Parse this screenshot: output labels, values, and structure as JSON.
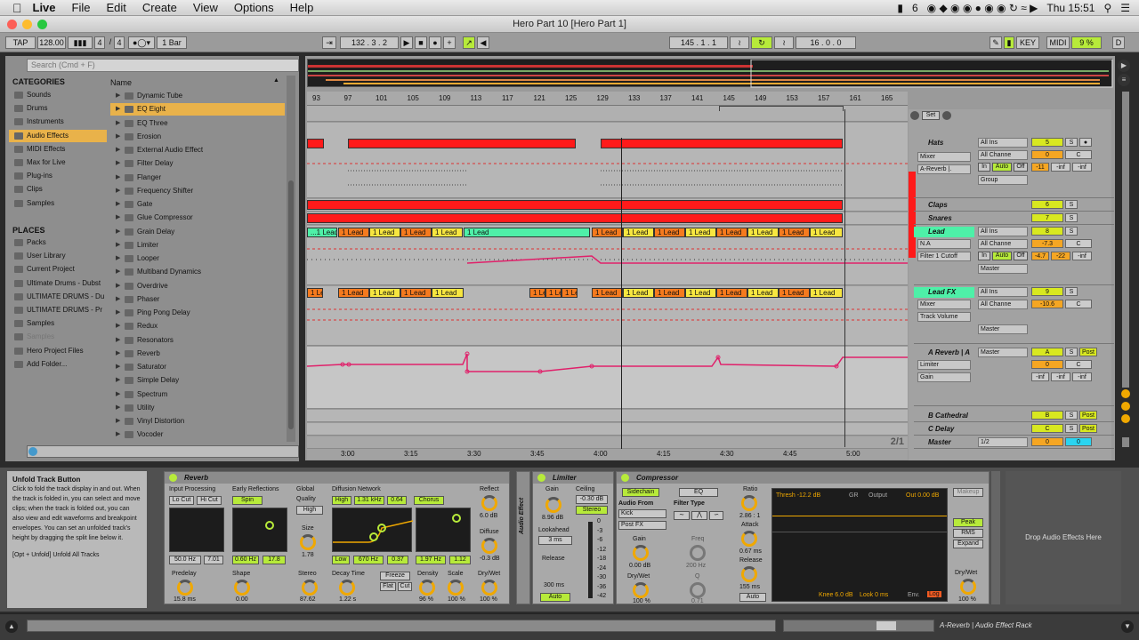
{
  "menubar": {
    "app": "Live",
    "items": [
      "File",
      "Edit",
      "Create",
      "View",
      "Options",
      "Help"
    ],
    "right": {
      "battery_num": "6",
      "clock": "Thu 15:51"
    }
  },
  "window": {
    "title": "Hero Part 10  [Hero Part 1]"
  },
  "transport": {
    "tap": "TAP",
    "bpm": "128.00",
    "meter_num": "4",
    "meter_den": "4",
    "quant": "1 Bar",
    "position": "132 .  3 .  2",
    "loop_start": "145 .  1 .  1",
    "loop_len": "16 .  0 .  0",
    "key": "KEY",
    "midi": "MIDI",
    "cpu": "9 %",
    "d": "D"
  },
  "browser": {
    "search_placeholder": "Search (Cmd + F)",
    "categories_label": "CATEGORIES",
    "name_header": "Name",
    "places_label": "PLACES",
    "categories": [
      "Sounds",
      "Drums",
      "Instruments",
      "Audio Effects",
      "MIDI Effects",
      "Max for Live",
      "Plug-ins",
      "Clips",
      "Samples"
    ],
    "places": [
      "Packs",
      "User Library",
      "Current Project",
      "Ultimate Drums - Dubst",
      "ULTIMATE DRUMS - Du",
      "ULTIMATE DRUMS - Pr",
      "Samples",
      "Samples",
      "Hero Project Files",
      "Add Folder..."
    ],
    "files": [
      "Dynamic Tube",
      "EQ Eight",
      "EQ Three",
      "Erosion",
      "External Audio Effect",
      "Filter Delay",
      "Flanger",
      "Frequency Shifter",
      "Gate",
      "Glue Compressor",
      "Grain Delay",
      "Limiter",
      "Looper",
      "Multiband Dynamics",
      "Overdrive",
      "Phaser",
      "Ping Pong Delay",
      "Redux",
      "Resonators",
      "Reverb",
      "Saturator",
      "Simple Delay",
      "Spectrum",
      "Utility",
      "Vinyl Distortion",
      "Vocoder"
    ]
  },
  "ruler": {
    "bars": [
      "93",
      "97",
      "101",
      "105",
      "109",
      "113",
      "117",
      "121",
      "125",
      "129",
      "133",
      "137",
      "141",
      "145",
      "149",
      "153",
      "157",
      "161",
      "165"
    ],
    "times": [
      "3:00",
      "3:15",
      "3:30",
      "3:45",
      "4:00",
      "4:15",
      "4:30",
      "4:45",
      "5:00"
    ],
    "page": "2/1",
    "set": "Set"
  },
  "clips": {
    "lead_label": "1 Lead",
    "lead_short": "1 Le",
    "lead_first": "...1 Lead"
  },
  "tracks": {
    "hats": {
      "name": "Hats",
      "input": "All Ins",
      "chain": "Mixer",
      "channel": "All Channe",
      "param": "A-Reverb |.",
      "in": "In",
      "auto": "Auto",
      "off": "Off",
      "group": "Group",
      "num": "5",
      "vol": "0",
      "pan": "C",
      "s1": "-11",
      "s2": "-inf",
      "s3": "-inf"
    },
    "claps": {
      "name": "Claps",
      "num": "6"
    },
    "snares": {
      "name": "Snares",
      "num": "7"
    },
    "lead": {
      "name": "Lead",
      "input": "All Ins",
      "chain": "N.A",
      "param": "Filter 1 Cutoff",
      "channel": "All Channe",
      "out": "Master",
      "num": "8",
      "vol": "-7.3",
      "pan": "C",
      "s1": "-4.7",
      "s2": "-22",
      "s3": "-inf"
    },
    "leadfx": {
      "name": "Lead FX",
      "input": "All Ins",
      "chain": "Mixer",
      "param": "Track Volume",
      "channel": "All Channe",
      "out": "Master",
      "num": "9",
      "vol": "-10.6",
      "pan": "C"
    },
    "areverb": {
      "name": "A Reverb | A",
      "out": "Master",
      "chain": "Limiter",
      "param": "Gain",
      "num": "A",
      "vol": "0",
      "pan": "C",
      "post": "Post"
    },
    "bcathedral": {
      "name": "B Cathedral",
      "num": "B",
      "post": "Post"
    },
    "cdelay": {
      "name": "C Delay",
      "num": "C",
      "post": "Post"
    },
    "master": {
      "name": "Master",
      "cue": "1/2",
      "vol": "0",
      "pan": "0"
    },
    "s_label": "S",
    "inf": "-inf"
  },
  "info": {
    "title": "Unfold Track Button",
    "body": "Click to fold the track display in and out. When the track is folded in, you can select and move clips; when the track is folded out, you can also view and edit waveforms and breakpoint envelopes. You can set an unfolded track's height by dragging the split line below it.",
    "shortcut": "[Opt + Unfold] Unfold All Tracks"
  },
  "reverb": {
    "title": "Reverb",
    "input_proc": "Input Processing",
    "lo_cut": "Lo Cut",
    "hi_cut": "Hi Cut",
    "in_lo": "50.0 Hz",
    "in_hi": "7.01",
    "predelay_label": "Predelay",
    "predelay": "15.8 ms",
    "early": "Early Reflections",
    "spin": "Spin",
    "spin_rate": "0.60 Hz",
    "spin_amt": "17.8",
    "shape_label": "Shape",
    "shape": "0.00",
    "global": "Global",
    "quality_label": "Quality",
    "quality": "High",
    "size_label": "Size",
    "size": "1.78",
    "stereo_label": "Stereo",
    "stereo": "87.62",
    "diffusion": "Diffusion Network",
    "high": "High",
    "high_freq": "1.31 kHz",
    "high_amt": "0.64",
    "chorus": "Chorus",
    "low": "Low",
    "low_freq": "670 Hz",
    "low_amt": "0.37",
    "chorus_rate": "1.97 Hz",
    "chorus_amt": "1.12",
    "decay_label": "Decay Time",
    "decay": "1.22 s",
    "freeze": "Freeze",
    "flat": "Flat",
    "cut": "Cut",
    "density_label": "Density",
    "density": "96 %",
    "scale_label": "Scale",
    "scale": "100 %",
    "reflect_label": "Reflect",
    "reflect": "6.0 dB",
    "diffuse_label": "Diffuse",
    "diffuse": "-0.3 dB",
    "drywet_label": "Dry/Wet",
    "drywet": "100 %"
  },
  "rack_label": "Audio Effect",
  "limiter": {
    "title": "Limiter",
    "gain_label": "Gain",
    "gain": "8.96 dB",
    "ceiling_label": "Ceiling",
    "ceiling": "-0.30 dB",
    "stereo": "Stereo",
    "lookahead_label": "Lookahead",
    "lookahead": "3 ms",
    "release_label": "Release",
    "release": "300 ms",
    "auto": "Auto",
    "scale": [
      "0",
      "-3",
      "-6",
      "-12",
      "-18",
      "-24",
      "-30",
      "-36",
      "-42"
    ]
  },
  "compressor": {
    "title": "Compressor",
    "sidechain": "Sidechain",
    "eq": "EQ",
    "audio_from": "Audio From",
    "source": "Kick",
    "tap": "Post FX",
    "gain_label": "Gain",
    "gain": "0.00 dB",
    "drywet_label": "Dry/Wet",
    "drywet": "100 %",
    "filter_type": "Filter Type",
    "freq_label": "Freq",
    "freq": "200 Hz",
    "q_label": "Q",
    "q": "0.71",
    "ratio_label": "Ratio",
    "ratio": "2.86 : 1",
    "attack_label": "Attack",
    "attack": "0.67 ms",
    "release_label": "Release",
    "release": "155 ms",
    "auto": "Auto",
    "thresh": "Thresh  -12.2 dB",
    "gr": "GR",
    "output": "Output",
    "out": "Out  0.00 dB",
    "knee": "Knee  6.0 dB",
    "look": "Look  0 ms",
    "env": "Env.",
    "log": "Log",
    "makeup": "Makeup",
    "peak": "Peak",
    "rms": "RMS",
    "expand": "Expand",
    "drywet2_label": "Dry/Wet",
    "drywet2": "100 %"
  },
  "drop_label": "Drop Audio Effects Here",
  "status": {
    "right": "A-Reverb | Audio Effect Rack"
  }
}
